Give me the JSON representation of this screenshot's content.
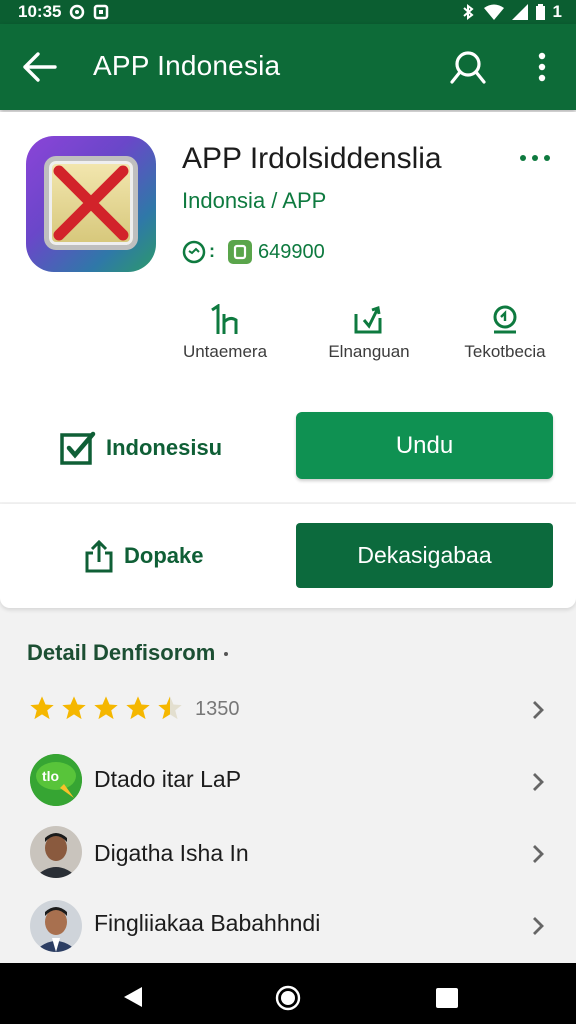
{
  "status_bar": {
    "time": "10:35",
    "battery": "1"
  },
  "app_bar": {
    "title": "APP Indonesia"
  },
  "app": {
    "name": "APP Irdolsiddenslia",
    "developer": "Indonsia / APP",
    "rating_sep": ":",
    "downloads": "649900"
  },
  "stats": [
    {
      "label": "Untaemera",
      "icon": "bar-chart-icon"
    },
    {
      "label": "Elnanguan",
      "icon": "download-icon"
    },
    {
      "label": "Tekotbecia",
      "icon": "badge-icon"
    }
  ],
  "actions": {
    "check_label": "Indonesisu",
    "install_label": "Undu",
    "share_label": "Dopake",
    "open_label": "Dekasigabaa"
  },
  "details": {
    "title": "Detail Denfisorom",
    "title_mark": "·",
    "rating": 4.5,
    "rating_count": "1350",
    "items": [
      {
        "label": "Dtado itar LaP",
        "icon": "chat-bubble-icon",
        "icon_text": "tlo"
      },
      {
        "label": "Digatha Isha In",
        "icon": "person-avatar"
      },
      {
        "label": "Fingliiakaa Babahhndi",
        "icon": "person-avatar"
      }
    ]
  },
  "colors": {
    "primary": "#0d6b38",
    "status_bar": "#0b5e31",
    "install": "#0f9152",
    "open": "#0c6a3d",
    "star": "#f5b700"
  }
}
